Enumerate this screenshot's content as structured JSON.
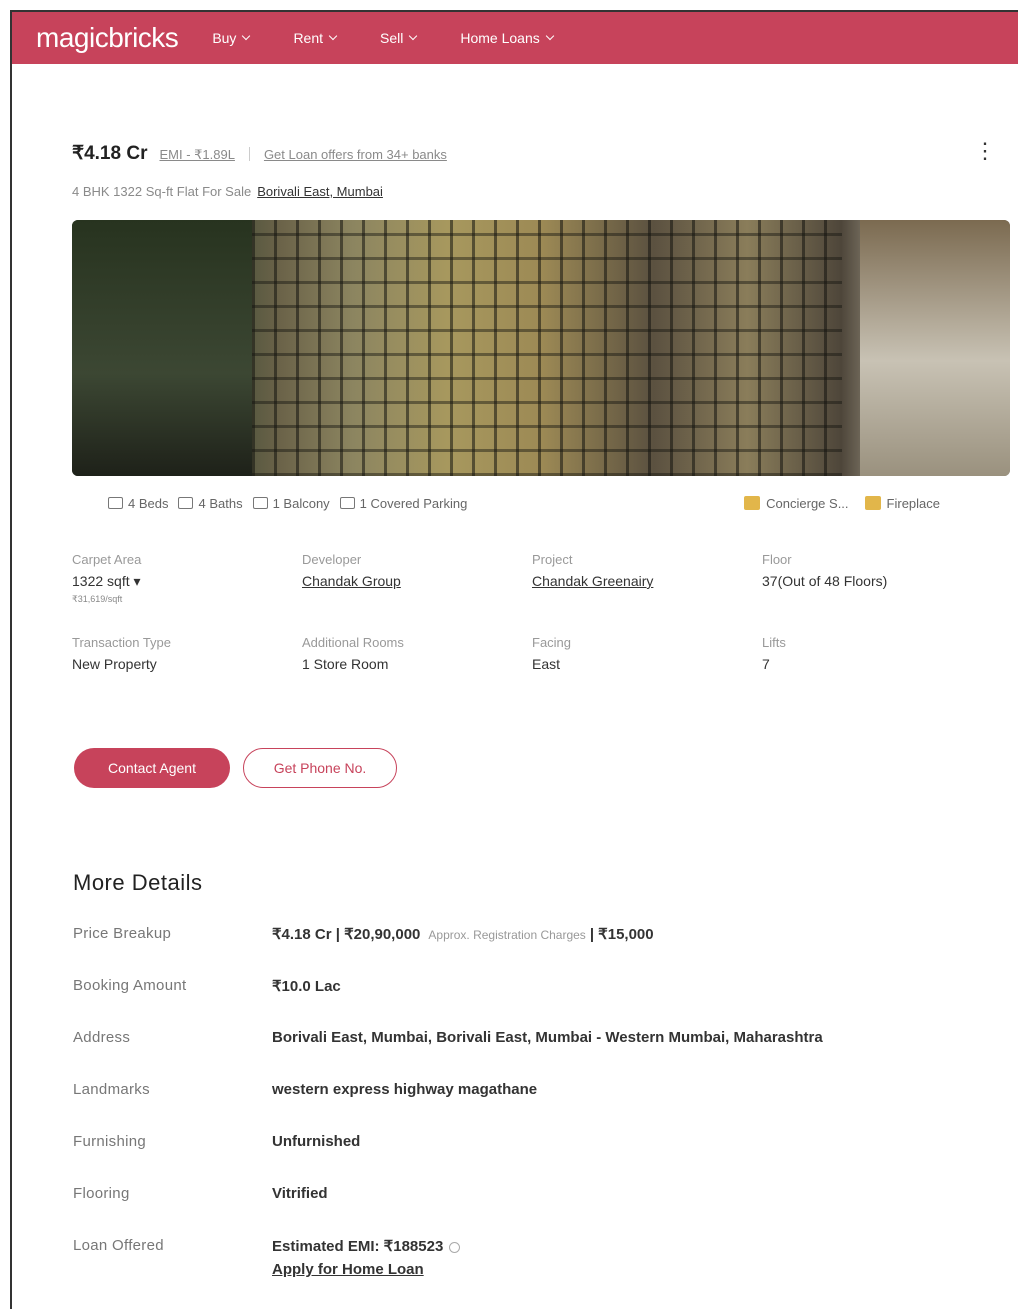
{
  "header": {
    "logo": "magicbricks",
    "nav": [
      {
        "label": "Buy"
      },
      {
        "label": "Rent"
      },
      {
        "label": "Sell"
      },
      {
        "label": "Home Loans"
      }
    ]
  },
  "listing": {
    "price": "₹4.18 Cr",
    "emi": "EMI - ₹1.89L",
    "loan_offers": "Get Loan offers from 34+ banks",
    "subtitle": "4 BHK 1322 Sq-ft Flat For Sale",
    "location": "Borivali East, Mumbai"
  },
  "amenities": {
    "left": [
      "4 Beds",
      "4 Baths",
      "1 Balcony",
      "1 Covered Parking"
    ],
    "right": [
      "Concierge S...",
      "Fireplace"
    ]
  },
  "summary": {
    "row1": [
      {
        "label": "Carpet Area",
        "value": "1322 sqft",
        "sub": "₹31,619/sqft"
      },
      {
        "label": "Developer",
        "value": "Chandak Group"
      },
      {
        "label": "Project",
        "value": "Chandak Greenairy"
      },
      {
        "label": "Floor",
        "value": "37(Out of 48 Floors)"
      }
    ],
    "row2": [
      {
        "label": "Transaction Type",
        "value": "New Property"
      },
      {
        "label": "Additional Rooms",
        "value": "1 Store Room"
      },
      {
        "label": "Facing",
        "value": "East"
      },
      {
        "label": "Lifts",
        "value": "7"
      }
    ]
  },
  "buttons": {
    "contact": "Contact Agent",
    "phone": "Get Phone No."
  },
  "more_details": {
    "title": "More Details",
    "price_breakup": {
      "label": "Price Breakup",
      "value": "₹4.18 Cr | ₹20,90,000",
      "small": "Approx. Registration Charges",
      "extra": "| ₹15,000"
    },
    "booking": {
      "label": "Booking Amount",
      "value": "₹10.0 Lac"
    },
    "address": {
      "label": "Address",
      "value": "Borivali East, Mumbai, Borivali East, Mumbai - Western Mumbai, Maharashtra"
    },
    "landmarks": {
      "label": "Landmarks",
      "value": "western express highway magathane"
    },
    "furnishing": {
      "label": "Furnishing",
      "value": "Unfurnished"
    },
    "flooring": {
      "label": "Flooring",
      "value": "Vitrified"
    },
    "loan": {
      "label": "Loan Offered",
      "value": "Estimated EMI: ₹188523",
      "link": "Apply for Home Loan"
    }
  }
}
